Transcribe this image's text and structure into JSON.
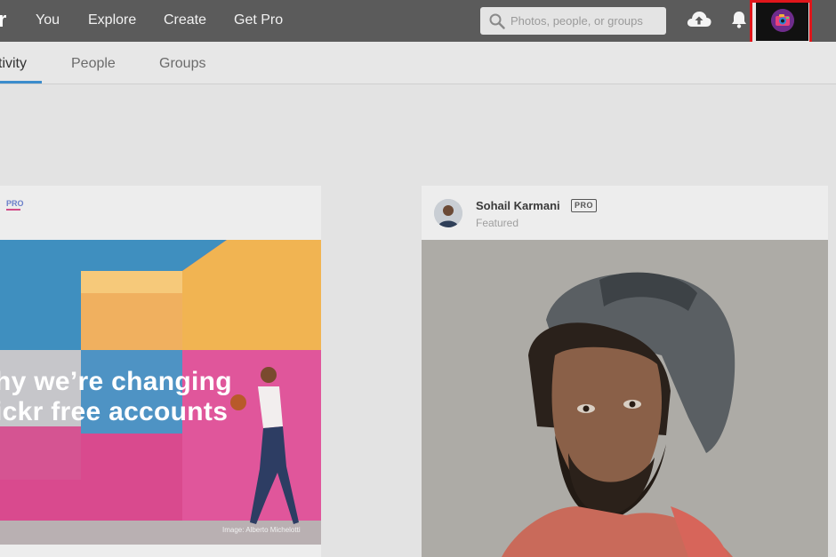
{
  "topbar": {
    "logo_fragment": "r",
    "nav": [
      {
        "label": "You"
      },
      {
        "label": "Explore"
      },
      {
        "label": "Create"
      },
      {
        "label": "Get Pro"
      }
    ],
    "search": {
      "placeholder": "Photos, people, or groups",
      "value": ""
    },
    "icons": [
      "search-icon",
      "upload-cloud-icon",
      "bell-icon",
      "camera-avatar-icon"
    ]
  },
  "subnav": {
    "tabs": [
      {
        "label": "tivity",
        "active": true
      },
      {
        "label": "People",
        "active": false
      },
      {
        "label": "Groups",
        "active": false
      }
    ]
  },
  "feed": {
    "left_card": {
      "pro_label": "PRO",
      "headline_line1": "hy we’re changing",
      "headline_line2": "ickr free accounts",
      "photo_credit": "Image: Alberto Michelotti"
    },
    "right_card": {
      "author": "Sohail Karmani",
      "badge": "PRO",
      "status": "Featured"
    }
  },
  "colors": {
    "topbar": "#5b5b5b",
    "page_background": "#e3e3e3",
    "active_tab_underline": "#3b8ccc",
    "highlight_box": "#e0161b"
  }
}
